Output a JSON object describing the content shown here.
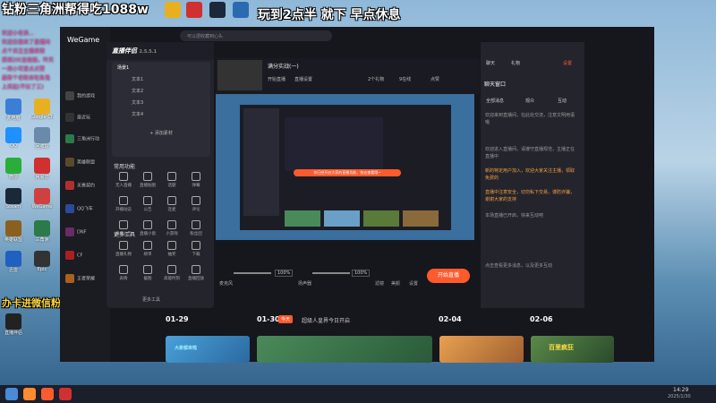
{
  "overlay": {
    "title_left": "钻粉三角洲帮得吃1088w",
    "title_right": "玩到2点半 就下 早点休息",
    "bottom_left": "办卡进微信粉丝群"
  },
  "chat_lines": [
    "欢迎小老弟...",
    "欢迎白银来了直播间",
    "点个关注主播谢谢",
    "感谢20(金姐姐，咋天",
    "一周小可爱点点赞",
    "最新个老粉来吃鱼鬼",
    "上房起(不拉了三)"
  ],
  "app": {
    "brand": "WeGame",
    "search_placeholder": "可以把收藏到心头",
    "sidebar": [
      {
        "label": "我的游戏",
        "color": "#444"
      },
      {
        "label": "最近玩",
        "color": "#333"
      },
      {
        "label": "三角洲行动",
        "color": "#2a7a4a"
      },
      {
        "label": "英雄联盟",
        "color": "#5a4a2a"
      },
      {
        "label": "无畏契约",
        "color": "#b03030"
      },
      {
        "label": "QQ飞车",
        "color": "#2a4a9a"
      },
      {
        "label": "DNF",
        "color": "#6a2a6a"
      },
      {
        "label": "CF",
        "color": "#aa2020"
      },
      {
        "label": "王者荣耀",
        "color": "#aa6020"
      }
    ],
    "dates": [
      "01-29",
      "01-30",
      "02-04",
      "02-06"
    ],
    "date_badge": "今天",
    "date_caption": "超级人皇界今日开启",
    "card_captions": [
      "大家都来啦",
      "百里疯狂"
    ]
  },
  "assistant": {
    "title": "直播伴侣",
    "version": "2.5.5.1",
    "scene_header": "场景1",
    "scene_items": [
      "文本1",
      "文本2",
      "文本3",
      "文本4"
    ],
    "add_source": "+ 添加素材",
    "section_tools": "常用功能",
    "tools": [
      "无人直播",
      "直播贴图",
      "话题",
      "弹幕",
      "开播动态",
      "公告",
      "连麦",
      "评论",
      "直播公告",
      "直播小窗",
      "小游戏",
      "粉丝团"
    ],
    "section_more": "更多工具",
    "more_tools": [
      "直播礼物",
      "榜单",
      "抽奖",
      "下载",
      "表情",
      "截图",
      "高能时刻",
      "直播回放"
    ],
    "more_link": "更多工具"
  },
  "stream": {
    "title": "满分实战(一)",
    "stats": [
      "2个礼物",
      "9在线",
      "点赞"
    ],
    "tabs": [
      "开始直播",
      "直播设置",
      "设置主播"
    ],
    "mic_label": "麦克风",
    "mic_value": "100%",
    "speaker_label": "扬声器",
    "speaker_value": "100%",
    "bar_icons": [
      "滤镜",
      "美颜",
      "设置"
    ],
    "start_button": "开始直播",
    "inner_banner": "你已经开启大家的直播功能，快去查看哦~"
  },
  "right": {
    "tabs": [
      "聊天",
      "礼物",
      "设置"
    ],
    "header": "聊天窗口",
    "subtabs": [
      "全部消息",
      "观众",
      "互动"
    ],
    "messages": [
      "欢迎来到直播间，在此处交流，注意文明用语哦",
      "欢迎进入直播间，请遵守直播规范，主播正在直播中",
      "新的特定用户加入，欢迎大家关注主播，领取免费的",
      "直播中注意安全，切勿私下交易，谨防诈骗，谢谢大家的支持",
      "本场直播已开启，快来互动吧"
    ],
    "footer": "点击查看更多消息，以及更多互动"
  },
  "taskbar": {
    "time": "14:29",
    "date": "2025/1/30"
  },
  "desktop_icons": [
    {
      "label": "此电脑",
      "color": "#3a7fd5"
    },
    {
      "label": "Google Chrome",
      "color": "#e8b020"
    },
    {
      "label": "QQ",
      "color": "#1e90ff"
    },
    {
      "label": "回收站",
      "color": "#6a8aaa"
    },
    {
      "label": "微信",
      "color": "#2aae3a"
    },
    {
      "label": "网易云",
      "color": "#d03030"
    },
    {
      "label": "Steam",
      "color": "#1b2838"
    },
    {
      "label": "WeGame",
      "color": "#d04040"
    },
    {
      "label": "英雄联盟",
      "color": "#8a6020"
    },
    {
      "label": "三角洲",
      "color": "#2a7a4a"
    },
    {
      "label": "迅雷",
      "color": "#2060c0"
    },
    {
      "label": "Epic",
      "color": "#333"
    },
    {
      "label": "直播伴侣",
      "color": "#222"
    }
  ],
  "colors": {
    "accent": "#ff5a2d",
    "overlay_pink": "#ff4fb3",
    "overlay_gold": "#ffd640"
  }
}
